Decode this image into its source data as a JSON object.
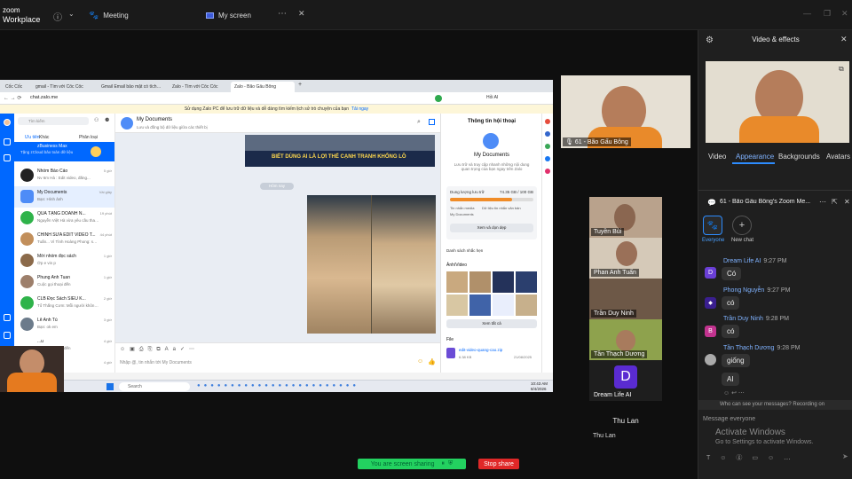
{
  "app": {
    "brand_line1": "zoom",
    "brand_line2": "Workplace"
  },
  "topbar": {
    "tabs": [
      {
        "label": "Meeting"
      },
      {
        "label": "My screen"
      }
    ]
  },
  "shared_screen": {
    "browser_tabs": [
      {
        "label": "Cốc Cốc"
      },
      {
        "label": "gmail - Tìm với Cốc Cốc"
      },
      {
        "label": "Gmail Email bảo mật có tích hợp"
      },
      {
        "label": "Zalo - Tìm với Cốc Cốc"
      },
      {
        "label": "Zalo - Bão Gấu Bông"
      }
    ],
    "url": "chat.zalo.me",
    "banner_text": "Sử dụng Zalo PC để lưu trữ dữ liệu và dễ dàng tìm kiếm lịch sử trò chuyện của bạn",
    "banner_link": "Tải ngay",
    "search_placeholder": "Tìm kiếm",
    "filter_tabs": [
      "Ưu tiên",
      "Khác",
      "Phân loại"
    ],
    "conversations": [
      {
        "name": "zBusiness Max",
        "preview": "Tặng zCloud bảo toàn dữ liệu",
        "time": ""
      },
      {
        "name": "Nhóm Báo Cáo",
        "preview": "Nv 6m Hà : Edit video, đăng...",
        "time": "5 giờ"
      },
      {
        "name": "My Documents",
        "preview": "Bạn: Hình ảnh",
        "time": "Vài giây"
      },
      {
        "name": "QUÀ TẶNG DOANH N...",
        "preview": "Nguyễn Việt Hà vừa yêu cầu tham...",
        "time": "19 phút"
      },
      {
        "name": "CHỈNH SỬA EDIT VIDEO T...",
        "preview": "Tuấn... Vì Tình Hoàng Phong: suc...",
        "time": "44 phút"
      },
      {
        "name": "Mời nhóm đọc sách",
        "preview": "Ớp e vin p",
        "time": "1 giờ"
      },
      {
        "name": "Phung Anh Tuan",
        "preview": "Cuộc gọi thoại đến",
        "time": "1 giờ"
      },
      {
        "name": "CLB Đọc Sách SIÊU K...",
        "preview": "Tổ Thắng Cơm: Mỗi người không...",
        "time": "2 giờ"
      },
      {
        "name": "Lê Anh Tú",
        "preview": "Bạn: ok em",
        "time": "3 giờ"
      },
      {
        "name": "...u",
        "preview": "Cuộc gọi thoại đến",
        "time": "4 giờ"
      },
      {
        "name": "...nh tuấn",
        "preview": "",
        "time": "4 giờ"
      }
    ],
    "chat_title": "My Documents",
    "chat_subtitle": "Lưu và đồng bộ dữ liệu giữa các thiết bị",
    "video_banner_text": "BIẾT DÙNG AI LÀ LỢI THẾ CẠNH TRANH KHỔNG LỒ",
    "date_chip": "Hôm nay",
    "composer_placeholder": "Nhập @, tin nhắn tới My Documents",
    "info_panel": {
      "title": "Thông tin hội thoại",
      "name": "My Documents",
      "desc": "Lưu trữ và truy cập nhanh những nội dung quan trọng của bạn ngay trên Zalo",
      "storage_label": "Dung lượng lưu trữ",
      "storage_value": "74.35 GB / 100 GB",
      "storage_fraction": 0.74,
      "legend": [
        "Tin nhắn media",
        "Dữ liệu tin nhắn văn bản",
        "My Documents"
      ],
      "cleanup_btn": "Xem và dọn dẹp",
      "reminders": "Danh sách nhắc hẹn",
      "media_section": "Ảnh/Video",
      "see_all": "Xem tất cả",
      "file_section": "File",
      "file_name": "edit-video-quang-cao.zip",
      "file_size": "6.38 KB",
      "file_date": "21/08/2025"
    },
    "taskbar_search": "Search",
    "taskbar_time": "10:43 AM",
    "taskbar_date": "8/4/2026"
  },
  "gallery": {
    "featured": {
      "name": "61 - Bão Gấu Bông"
    },
    "tiles": [
      {
        "name": "Tuyền Bùi"
      },
      {
        "name": "Phan Anh Tuấn"
      },
      {
        "name": "Trần Duy Ninh"
      },
      {
        "name": "Tần Thạch Dương"
      },
      {
        "name": "Dream Life AI",
        "initial": "D"
      }
    ],
    "below_name": "Thu Lan",
    "below_label": "Thu Lan"
  },
  "video_effects": {
    "title": "Video & effects",
    "tabs": [
      "Video",
      "Appearance",
      "Backgrounds",
      "Avatars"
    ]
  },
  "chat": {
    "title": "61 - Bão Gấu Bông's Zoom Me...",
    "targets": [
      {
        "label": "Everyone"
      },
      {
        "label": "New chat"
      }
    ],
    "messages": [
      {
        "sender": "Dream Life AI",
        "time": "9:27 PM",
        "text": "Có",
        "initial": "D",
        "color": "#6a3fd6"
      },
      {
        "sender": "Phong Nguyễn",
        "time": "9:27 PM",
        "text": "có",
        "initial": "",
        "color": "#5a2bd1"
      },
      {
        "sender": "Trần Duy Ninh",
        "time": "9:28 PM",
        "text": "có",
        "initial": "B",
        "color": "#c2338f"
      },
      {
        "sender": "Tần Thạch Dương",
        "time": "9:28 PM",
        "text": "giống",
        "initial": "",
        "color": "#888888"
      }
    ],
    "extra_text": "AI",
    "privacy_note": "Who can see your messages? Recording on",
    "input_placeholder": "Message everyone",
    "activate_title": "Activate Windows",
    "activate_sub": "Go to Settings to activate Windows."
  },
  "bottom": {
    "sharing_text": "You are screen sharing",
    "stop_text": "Stop share"
  }
}
